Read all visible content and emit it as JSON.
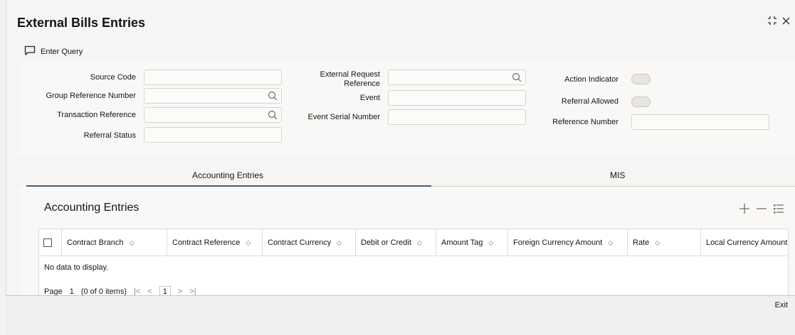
{
  "window": {
    "title": "External Bills Entries",
    "controls": [
      "restore-icon",
      "close-icon"
    ]
  },
  "toolbar": {
    "enter_query_label": "Enter Query"
  },
  "form": {
    "source_code": {
      "label": "Source Code",
      "value": ""
    },
    "group_reference_number": {
      "label": "Group Reference Number",
      "value": ""
    },
    "transaction_reference": {
      "label": "Transaction Reference",
      "value": ""
    },
    "referral_status": {
      "label": "Referral Status",
      "value": ""
    },
    "external_request_reference": {
      "label_line1": "External Request",
      "label_line2": "Reference",
      "value": ""
    },
    "event": {
      "label": "Event",
      "value": ""
    },
    "event_serial_number": {
      "label": "Event Serial Number",
      "value": ""
    },
    "action_indicator": {
      "label": "Action Indicator",
      "on": false
    },
    "referral_allowed": {
      "label": "Referral Allowed",
      "on": false
    },
    "reference_number": {
      "label": "Reference Number",
      "value": ""
    }
  },
  "tabs": [
    {
      "label": "Accounting Entries",
      "active": true
    },
    {
      "label": "MIS",
      "active": false
    }
  ],
  "grid": {
    "title": "Accounting Entries",
    "tools": [
      "add-icon",
      "remove-icon",
      "list-icon"
    ],
    "columns": [
      "Contract Branch",
      "Contract Reference",
      "Contract Currency",
      "Debit or Credit",
      "Amount Tag",
      "Foreign Currency Amount",
      "Rate",
      "Local Currency Amount"
    ],
    "rows": [],
    "empty_text": "No data to display.",
    "pager": {
      "page_label": "Page",
      "page_value": "1",
      "items_text": "(0 of 0 items)",
      "first": "|<",
      "prev": "<",
      "current": "1",
      "next": ">",
      "last": ">|"
    }
  },
  "footer": {
    "exit_label": "Exit"
  },
  "colors": {
    "accent": "#3b6183",
    "text": "#161513",
    "border": "#d6d4d0"
  }
}
